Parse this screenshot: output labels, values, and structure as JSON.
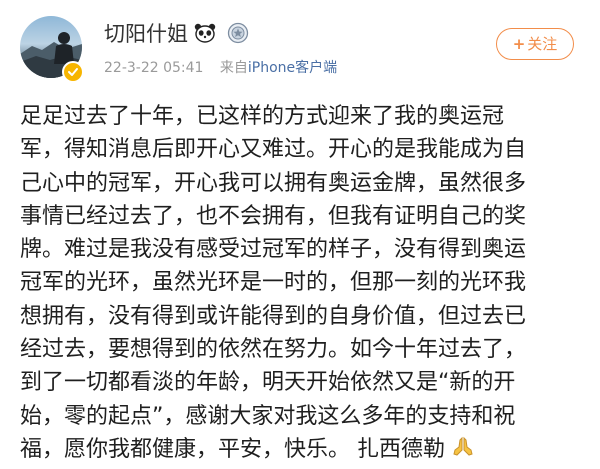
{
  "post": {
    "author": "切阳什姐",
    "badges": [
      "panda-icon",
      "gold-medal-icon"
    ],
    "timestamp": "22-3-22 05:41",
    "source_prefix": "来自",
    "source_client": "iPhone客户端",
    "follow_label": "关注",
    "follow_plus": "+",
    "lines": [
      "足足过去了十年，已这样的方式迎来了我的奥运冠",
      "军，得知消息后即开心又难过。开心的是我能成为自",
      "己心中的冠军，开心我可以拥有奥运金牌，虽然很多",
      "事情已经过去了，也不会拥有，但我有证明自己的奖",
      "牌。难过是我没有感受过冠军的样子，没有得到奥运",
      "冠军的光环，虽然光环是一时的，但那一刻的光环我",
      "想拥有，没有得到或许能得到的自身价值，但过去已",
      "经过去，要想得到的依然在努力。如今十年过去了，",
      "到了一切都看淡的年龄，明天开始依然又是“新的开",
      "始，零的起点”，感谢大家对我这么多年的支持和祝",
      "福，愿你我都健康，平安，快乐。 扎西德勒"
    ],
    "end_icon": "praying-hands-icon"
  },
  "colors": {
    "follow": "#f28d4a",
    "meta": "#9a9a9a",
    "client_link": "#4a6fa5",
    "verified": "#f7b500"
  }
}
